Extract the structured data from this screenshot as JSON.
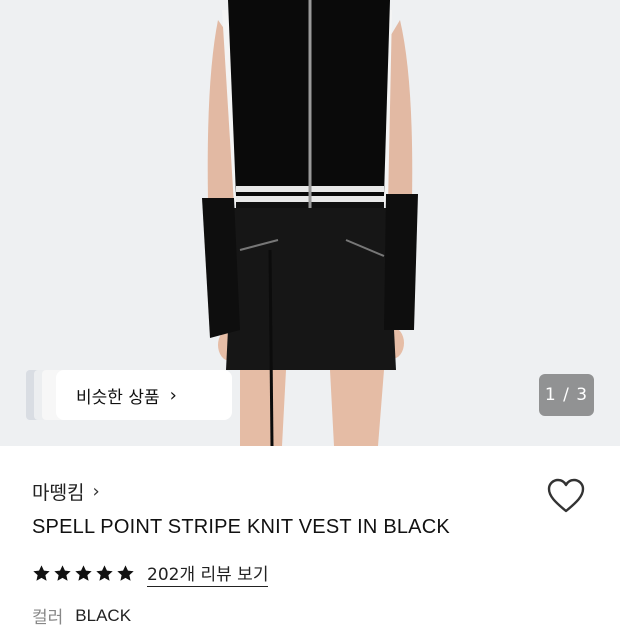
{
  "gallery": {
    "similar_button_label": "비슷한 상품",
    "similar_button_chevron": "›",
    "counter": "1 / 3"
  },
  "product": {
    "brand": "마뗑킴",
    "brand_chevron": "›",
    "title": "SPELL POINT STRIPE KNIT VEST IN BLACK",
    "rating_stars": 5,
    "review_link": "202개 리뷰 보기",
    "color_label": "컬러",
    "color_value": "BLACK",
    "wishlist_icon": "heart-outline-icon"
  },
  "colors": {
    "background": "#ffffff",
    "hero_background": "#eef0f2",
    "star": "#111111",
    "counter_bg": "#6e6e6e"
  }
}
